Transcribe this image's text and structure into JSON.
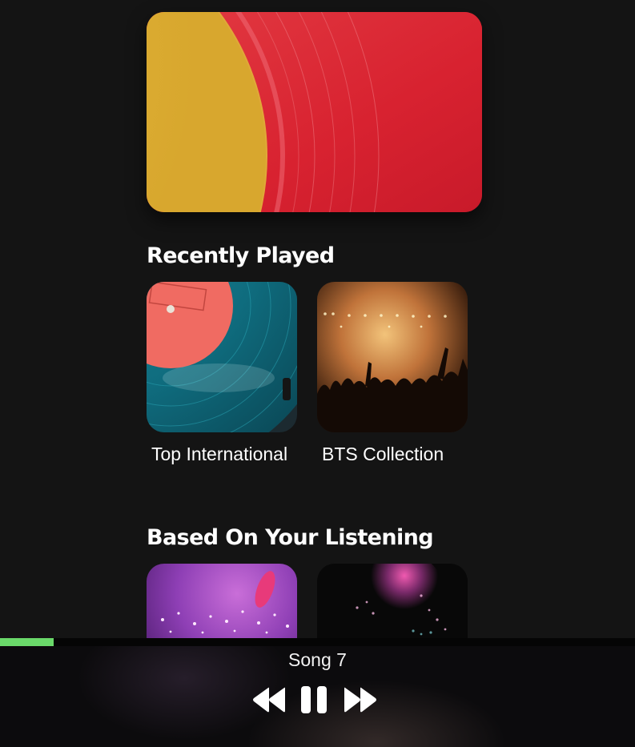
{
  "hero": {
    "image": "vinyl-record-red-yellow"
  },
  "sections": {
    "recently_played": {
      "title": "Recently Played",
      "items": [
        {
          "label": "Top International",
          "image": "turntable-teal-vinyl"
        },
        {
          "label": "BTS Collection",
          "image": "concert-crowd-lights"
        }
      ]
    },
    "based_on_listening": {
      "title": "Based On Your Listening",
      "items": [
        {
          "image": "purple-fireworks"
        },
        {
          "image": "pink-fireworks-dark"
        }
      ]
    }
  },
  "player": {
    "song_title": "Song 7",
    "progress": 0.085,
    "accent_color": "#6ad96a",
    "controls": {
      "previous_icon": "rewind-icon",
      "pause_icon": "pause-icon",
      "next_icon": "fast-forward-icon"
    }
  }
}
